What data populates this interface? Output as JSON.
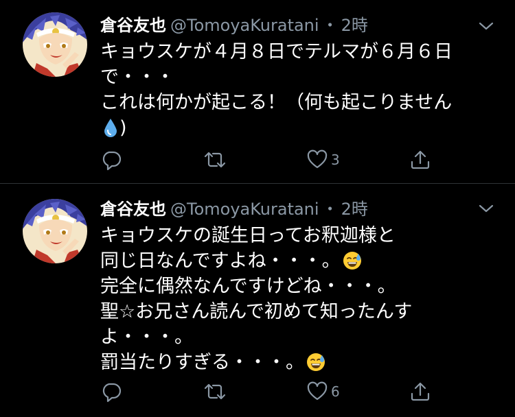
{
  "tweets": [
    {
      "display_name": "倉谷友也",
      "handle": "@TomoyaKuratani",
      "separator": "・",
      "time": "2時",
      "avatar_icon": "avatar-image",
      "lines": [
        "キョウスケが４月８日でテルマが６月６日",
        "で・・・",
        "これは何かが起こる！（何も起こりません",
        ")"
      ],
      "line_emoji": [
        null,
        null,
        null,
        "droplet-emoji"
      ],
      "actions": {
        "reply_icon": "reply-icon",
        "retweet_icon": "retweet-icon",
        "like_icon": "heart-icon",
        "like_count": "3",
        "share_icon": "share-icon"
      }
    },
    {
      "display_name": "倉谷友也",
      "handle": "@TomoyaKuratani",
      "separator": "・",
      "time": "2時",
      "avatar_icon": "avatar-image",
      "lines": [
        "キョウスケの誕生日ってお釈迦様と",
        "同じ日なんですよね・・・。",
        "完全に偶然なんですけどね・・・。",
        "聖☆お兄さん読んで初めて知ったんす",
        "よ・・・。",
        "罰当たりすぎる・・・。"
      ],
      "line_emoji": [
        null,
        "sweat-smile-emoji",
        null,
        null,
        null,
        "sweat-smile-emoji"
      ],
      "actions": {
        "reply_icon": "reply-icon",
        "retweet_icon": "retweet-icon",
        "like_icon": "heart-icon",
        "like_count": "6",
        "share_icon": "share-icon"
      }
    }
  ],
  "colors": {
    "background": "#000000",
    "text_primary": "#ffffff",
    "text_secondary": "#8b98a5",
    "divider": "#2f3336"
  }
}
